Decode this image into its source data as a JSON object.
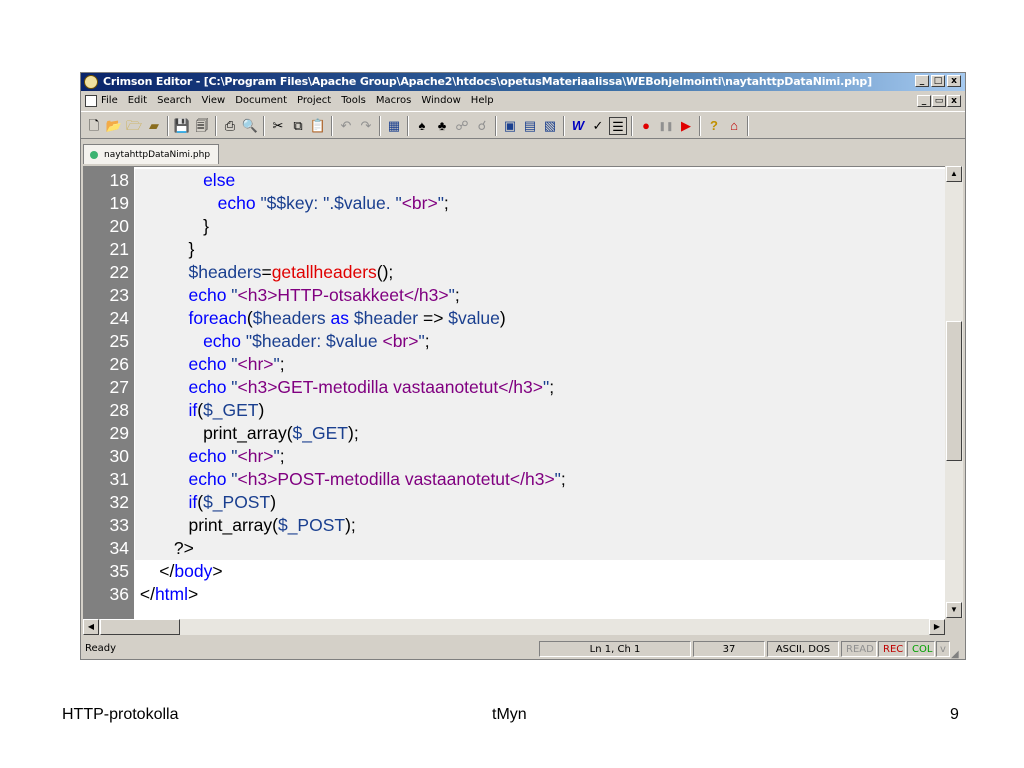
{
  "window": {
    "title": "Crimson Editor - [C:\\Program Files\\Apache Group\\Apache2\\htdocs\\opetusMateriaalissa\\WEBohjelmointi\\naytahttpDataNimi.php]",
    "min": "_",
    "max": "□",
    "close": "x"
  },
  "menu": [
    "File",
    "Edit",
    "Search",
    "View",
    "Document",
    "Project",
    "Tools",
    "Macros",
    "Window",
    "Help"
  ],
  "mdi": {
    "min": "_",
    "restore": "▭",
    "close": "x"
  },
  "toolbar": {
    "icons": [
      "new-file-icon",
      "open-icon",
      "open-remote-icon",
      "open-folder-icon",
      "save-icon",
      "save-all-icon",
      "print-icon",
      "print-preview-icon",
      "cut-icon",
      "copy-icon",
      "paste-icon",
      "undo-icon",
      "redo-icon",
      "column-mode-icon",
      "find-icon",
      "find-next-icon",
      "replace-icon",
      "replace-next-icon",
      "toggle-output-icon",
      "toggle-directory-icon",
      "toggle-project-icon",
      "word-wrap-icon",
      "spell-check-icon",
      "line-numbers-icon",
      "record-macro-icon",
      "pause-macro-icon",
      "play-macro-icon",
      "help-icon",
      "home-icon"
    ]
  },
  "tab": {
    "label": "naytahttpDataNimi.php"
  },
  "code_lines": [
    {
      "n": "18",
      "tokens": [
        [
          "plain",
          "              "
        ],
        [
          "kw",
          "else"
        ]
      ]
    },
    {
      "n": "19",
      "tokens": [
        [
          "plain",
          "                 "
        ],
        [
          "kw",
          "echo "
        ],
        [
          "var",
          "\"$$key: \".$value. \""
        ],
        [
          "str",
          "<br>"
        ],
        [
          "var",
          "\""
        ],
        [
          "plain",
          ";"
        ]
      ]
    },
    {
      "n": "20",
      "tokens": [
        [
          "plain",
          "              }"
        ]
      ]
    },
    {
      "n": "21",
      "tokens": [
        [
          "plain",
          "           }"
        ]
      ]
    },
    {
      "n": "22",
      "tokens": [
        [
          "plain",
          "           "
        ],
        [
          "var",
          "$headers"
        ],
        [
          "plain",
          "="
        ],
        [
          "fn",
          "getallheaders"
        ],
        [
          "plain",
          "();"
        ]
      ]
    },
    {
      "n": "23",
      "tokens": [
        [
          "plain",
          "           "
        ],
        [
          "kw",
          "echo "
        ],
        [
          "var",
          "\""
        ],
        [
          "str",
          "<h3>HTTP-otsakkeet</h3>"
        ],
        [
          "var",
          "\""
        ],
        [
          "plain",
          ";"
        ]
      ]
    },
    {
      "n": "24",
      "tokens": [
        [
          "plain",
          "           "
        ],
        [
          "kw",
          "foreach"
        ],
        [
          "plain",
          "("
        ],
        [
          "var",
          "$headers "
        ],
        [
          "kw",
          "as "
        ],
        [
          "var",
          "$header "
        ],
        [
          "plain",
          "=> "
        ],
        [
          "var",
          "$value"
        ],
        [
          "plain",
          ")"
        ]
      ]
    },
    {
      "n": "25",
      "tokens": [
        [
          "plain",
          "              "
        ],
        [
          "kw",
          "echo "
        ],
        [
          "var",
          "\"$header: $value "
        ],
        [
          "str",
          "<br>"
        ],
        [
          "var",
          "\""
        ],
        [
          "plain",
          ";"
        ]
      ]
    },
    {
      "n": "26",
      "tokens": [
        [
          "plain",
          "           "
        ],
        [
          "kw",
          "echo "
        ],
        [
          "var",
          "\""
        ],
        [
          "str",
          "<hr>"
        ],
        [
          "var",
          "\""
        ],
        [
          "plain",
          ";"
        ]
      ]
    },
    {
      "n": "27",
      "tokens": [
        [
          "plain",
          "           "
        ],
        [
          "kw",
          "echo "
        ],
        [
          "var",
          "\""
        ],
        [
          "str",
          "<h3>GET-metodilla vastaanotetut</h3>"
        ],
        [
          "var",
          "\""
        ],
        [
          "plain",
          ";"
        ]
      ]
    },
    {
      "n": "28",
      "tokens": [
        [
          "plain",
          "           "
        ],
        [
          "kw",
          "if"
        ],
        [
          "plain",
          "("
        ],
        [
          "var",
          "$_GET"
        ],
        [
          "plain",
          ")"
        ]
      ]
    },
    {
      "n": "29",
      "tokens": [
        [
          "plain",
          "              print_array("
        ],
        [
          "var",
          "$_GET"
        ],
        [
          "plain",
          ");"
        ]
      ]
    },
    {
      "n": "30",
      "tokens": [
        [
          "plain",
          "           "
        ],
        [
          "kw",
          "echo "
        ],
        [
          "var",
          "\""
        ],
        [
          "str",
          "<hr>"
        ],
        [
          "var",
          "\""
        ],
        [
          "plain",
          ";"
        ]
      ]
    },
    {
      "n": "31",
      "tokens": [
        [
          "plain",
          "           "
        ],
        [
          "kw",
          "echo "
        ],
        [
          "var",
          "\""
        ],
        [
          "str",
          "<h3>POST-metodilla vastaanotetut</h3>"
        ],
        [
          "var",
          "\""
        ],
        [
          "plain",
          ";"
        ]
      ]
    },
    {
      "n": "32",
      "tokens": [
        [
          "plain",
          "           "
        ],
        [
          "kw",
          "if"
        ],
        [
          "plain",
          "("
        ],
        [
          "var",
          "$_POST"
        ],
        [
          "plain",
          ")"
        ]
      ]
    },
    {
      "n": "33",
      "tokens": [
        [
          "plain",
          "           print_array("
        ],
        [
          "var",
          "$_POST"
        ],
        [
          "plain",
          ");"
        ]
      ]
    },
    {
      "n": "34",
      "tokens": [
        [
          "plain",
          "        ?>"
        ]
      ]
    },
    {
      "n": "35",
      "tokens": [
        [
          "plain",
          "     </"
        ],
        [
          "kw",
          "body"
        ],
        [
          "plain",
          ">"
        ]
      ]
    },
    {
      "n": "36",
      "tokens": [
        [
          "plain",
          " </"
        ],
        [
          "kw",
          "html"
        ],
        [
          "plain",
          ">"
        ]
      ]
    }
  ],
  "status": {
    "ready": "Ready",
    "position": "Ln 1, Ch 1",
    "lines": "37",
    "encoding": "ASCII, DOS",
    "read": "READ",
    "rec": "REC",
    "col": "COL",
    "ovr": "v"
  },
  "footer": {
    "left": "HTTP-protokolla",
    "center": "tMyn",
    "right": "9"
  }
}
